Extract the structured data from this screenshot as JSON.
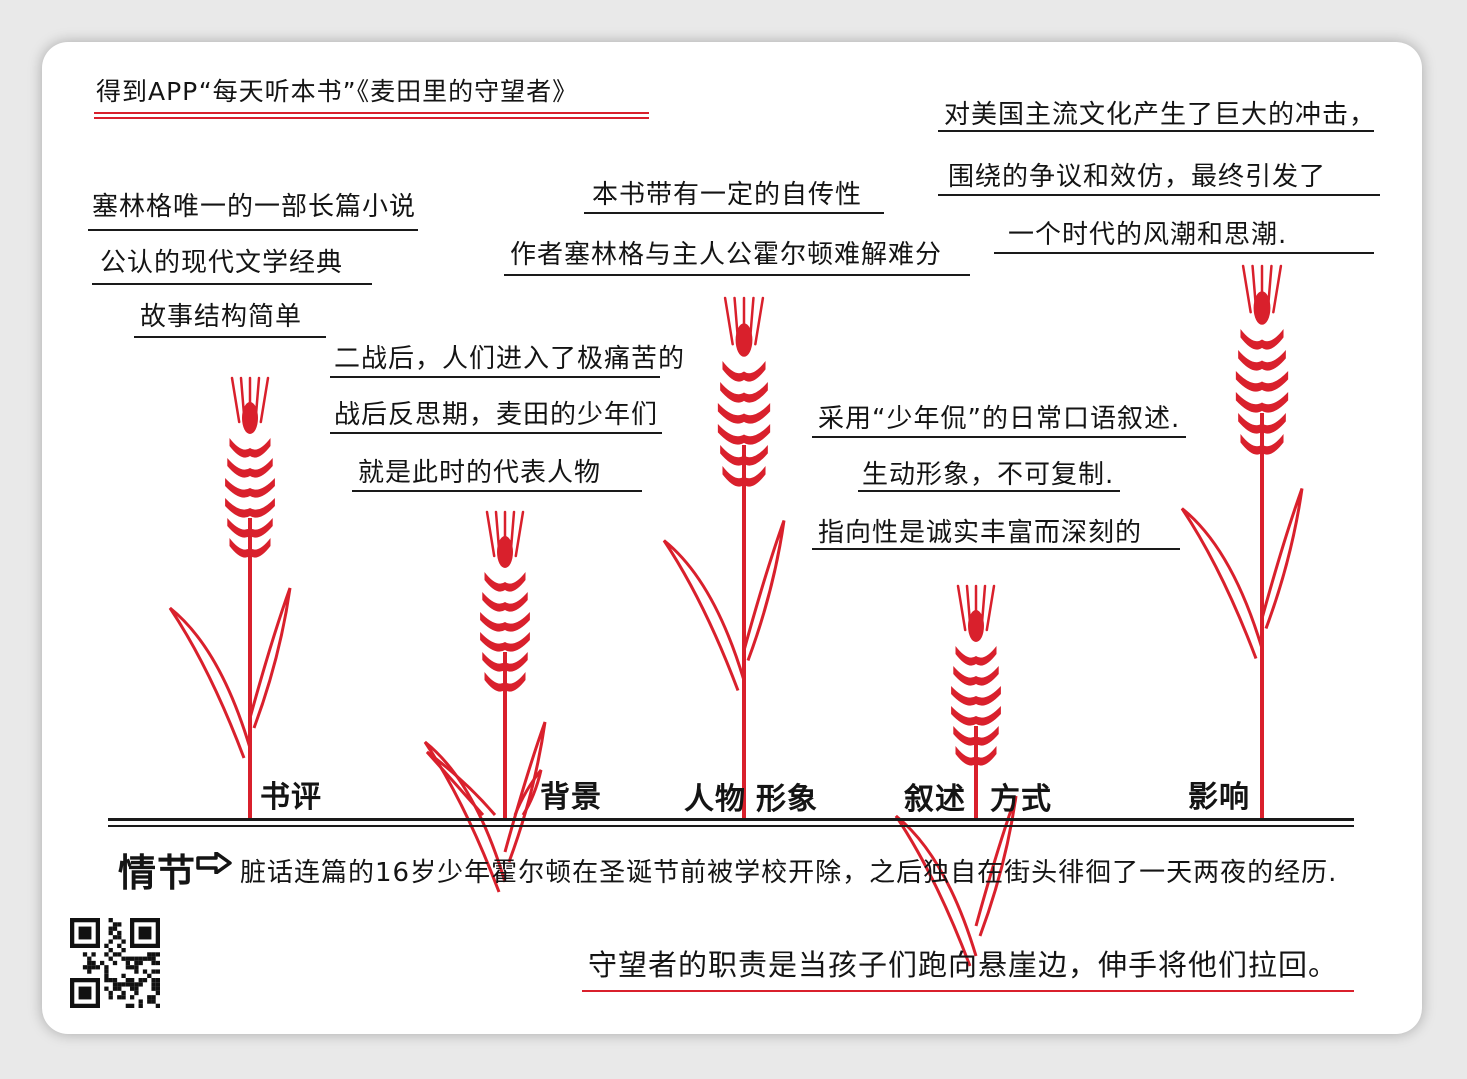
{
  "title": "得到APP“每天听本书”《麦田里的守望者》",
  "colors": {
    "accent": "#d9202c",
    "ink": "#141414",
    "paper": "#ffffff"
  },
  "stalks": [
    {
      "label": "书评",
      "notes": [
        "塞林格唯一的一部长篇小说",
        "公认的现代文学经典",
        "故事结构简单"
      ]
    },
    {
      "label": "背景",
      "notes": [
        "二战后，人们进入了极痛苦的",
        "战后反思期，麦田的少年们",
        "就是此时的代表人物"
      ]
    },
    {
      "label": "人物形象",
      "label_a": "人物",
      "label_b": "形象",
      "notes": [
        "本书带有一定的自传性",
        "作者塞林格与主人公霍尔顿难解难分"
      ]
    },
    {
      "label": "叙述方式",
      "label_a": "叙述",
      "label_b": "方式",
      "notes": [
        "采用“少年侃”的日常口语叙述.",
        "生动形象，不可复制.",
        "指向性是诚实丰富而深刻的"
      ]
    },
    {
      "label": "影响",
      "notes": [
        "对美国主流文化产生了巨大的冲击，",
        "围绕的争议和效仿，最终引发了",
        "一个时代的风潮和思潮."
      ]
    }
  ],
  "plot": {
    "label": "情节",
    "arrow_icon": "right-arrow-icon",
    "text": "脏话连篇的16岁少年霍尔顿在圣诞节前被学校开除，之后独自在街头徘徊了一天两夜的经历."
  },
  "quote": "守望者的职责是当孩子们跑向悬崖边，伸手将他们拉回。",
  "qr_icon": "qr-code-icon"
}
